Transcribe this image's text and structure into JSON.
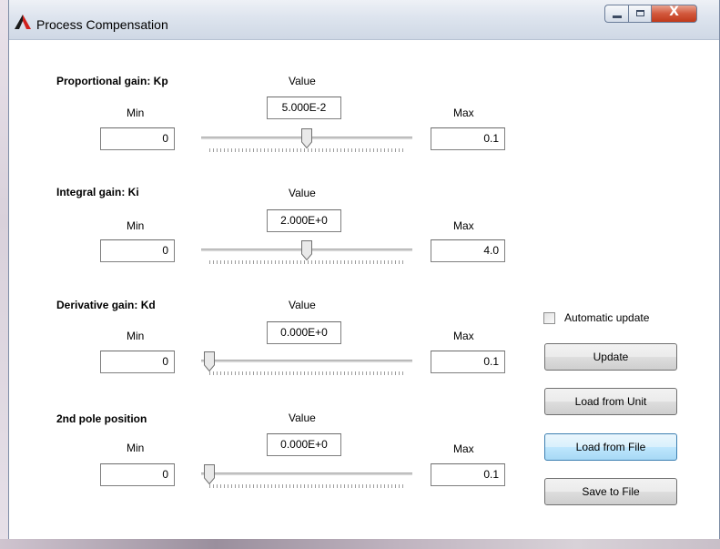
{
  "window": {
    "title": "Process Compensation",
    "close_glyph": "X"
  },
  "params": [
    {
      "title": "Proportional gain: Kp",
      "value_label": "Value",
      "value": "5.000E-2",
      "min_label": "Min",
      "min": "0",
      "max_label": "Max",
      "max": "0.1",
      "slider_position": 0.5
    },
    {
      "title": "Integral gain: Ki",
      "value_label": "Value",
      "value": "2.000E+0",
      "min_label": "Min",
      "min": "0",
      "max_label": "Max",
      "max": "4.0",
      "slider_position": 0.5
    },
    {
      "title": "Derivative gain: Kd",
      "value_label": "Value",
      "value": "0.000E+0",
      "min_label": "Min",
      "min": "0",
      "max_label": "Max",
      "max": "0.1",
      "slider_position": 0.0
    },
    {
      "title": "2nd pole position",
      "value_label": "Value",
      "value": "0.000E+0",
      "min_label": "Min",
      "min": "0",
      "max_label": "Max",
      "max": "0.1",
      "slider_position": 0.0
    }
  ],
  "auto_update": {
    "label": "Automatic update",
    "checked": false
  },
  "buttons": {
    "update": "Update",
    "load_unit": "Load from Unit",
    "load_file": "Load from File",
    "save_file": "Save to File"
  },
  "colors": {
    "logo_dark": "#1a1a1a",
    "logo_red": "#d0211c",
    "close_button": "#c0391b",
    "focus_border": "#3c7fb1"
  }
}
